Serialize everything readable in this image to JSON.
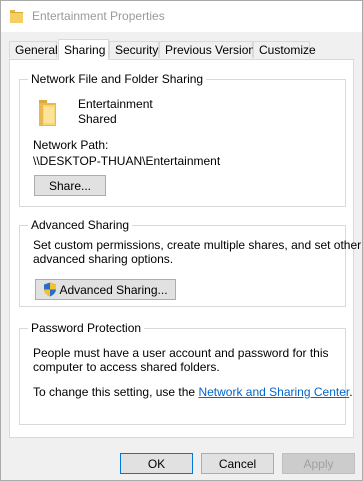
{
  "window": {
    "title": "Entertainment Properties"
  },
  "tabs": [
    {
      "label": "General"
    },
    {
      "label": "Sharing",
      "active": true
    },
    {
      "label": "Security"
    },
    {
      "label": "Previous Versions"
    },
    {
      "label": "Customize"
    }
  ],
  "network_sharing": {
    "group_title": "Network File and Folder Sharing",
    "folder_name": "Entertainment",
    "folder_status": "Shared",
    "path_label": "Network Path:",
    "path_value": "\\\\DESKTOP-THUAN\\Entertainment",
    "share_button": "Share..."
  },
  "advanced_sharing": {
    "group_title": "Advanced Sharing",
    "description_line1": "Set custom permissions, create multiple shares, and set other",
    "description_line2": "advanced sharing options.",
    "button": "Advanced Sharing..."
  },
  "password_protection": {
    "group_title": "Password Protection",
    "description_line1": "People must have a user account and password for this",
    "description_line2": "computer to access shared folders.",
    "change_prefix": "To change this setting, use the ",
    "link_text": "Network and Sharing Center",
    "change_suffix": "."
  },
  "footer": {
    "ok": "OK",
    "cancel": "Cancel",
    "apply": "Apply"
  },
  "icons": {
    "title": "folder-icon",
    "folder": "folder-icon",
    "shield": "uac-shield-icon"
  }
}
